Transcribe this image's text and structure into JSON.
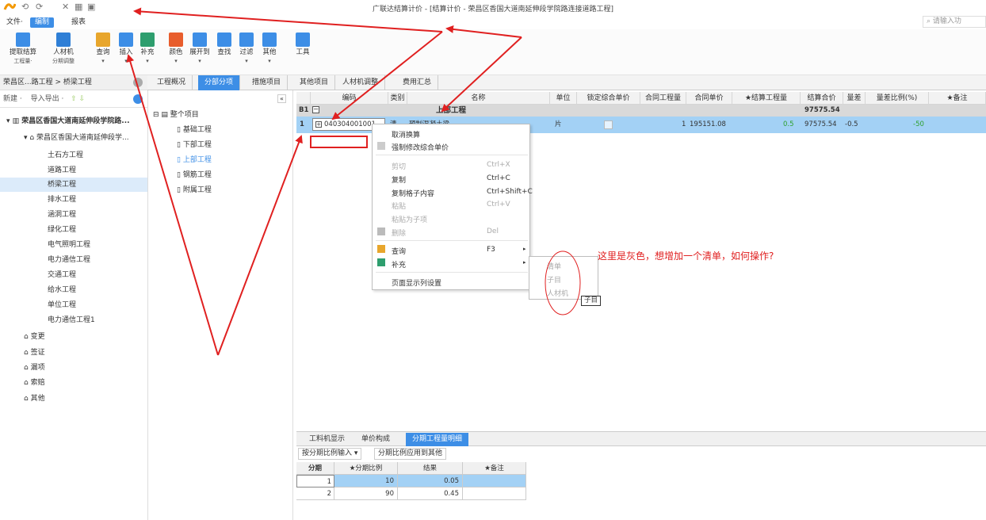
{
  "app": {
    "title": "广联达结算计价 - [结算计价 - 荣昌区香国大道南延伸段学院路连接道路工程]",
    "quick_access": [
      "⟲",
      "⟳",
      "✕",
      "▦",
      "▣"
    ]
  },
  "menu": {
    "tabs": [
      {
        "label": "文件·"
      },
      {
        "label": "编制"
      },
      {
        "label": "报表"
      }
    ],
    "search_placeholder": "请输入功"
  },
  "ribbon": {
    "buttons": [
      {
        "label": "提取结算",
        "sub": "工程量·"
      },
      {
        "label": "人材机",
        "sub": "分期调整"
      },
      {
        "label": "查询",
        "sub": "▾"
      },
      {
        "label": "插入",
        "sub": "▾"
      },
      {
        "label": "补充",
        "sub": "▾"
      },
      {
        "label": "颜色",
        "sub": "▾"
      },
      {
        "label": "展开到",
        "sub": "▾"
      },
      {
        "label": "查找",
        "sub": ""
      },
      {
        "label": "过滤",
        "sub": "▾"
      },
      {
        "label": "其他",
        "sub": "▾"
      },
      {
        "label": "工具",
        "sub": ""
      }
    ]
  },
  "left": {
    "breadcrumb": "荣昌区...路工程 > 桥梁工程",
    "toolbar": {
      "new": "新建 ·",
      "io": "导入导出 ·"
    },
    "project": "荣昌区香国大道南延伸段学院路...",
    "unit": "荣昌区香国大道南延伸段学...",
    "items": [
      "土石方工程",
      "道路工程",
      "桥梁工程",
      "排水工程",
      "涵洞工程",
      "绿化工程",
      "电气照明工程",
      "电力通信工程",
      "交通工程",
      "给水工程",
      "单位工程",
      "电力通信工程1"
    ],
    "extras": [
      "变更",
      "签证",
      "漏项",
      "索赔",
      "其他"
    ]
  },
  "mid": {
    "root": "整个项目",
    "nodes": [
      "基础工程",
      "下部工程",
      "上部工程",
      "钢筋工程",
      "附属工程"
    ]
  },
  "tabs": [
    "工程概况",
    "分部分项",
    "措施项目",
    "其他项目",
    "人材机调整",
    "费用汇总"
  ],
  "grid": {
    "headers": [
      "编码",
      "类别",
      "名称",
      "单位",
      "锁定综合单价",
      "合同工程量",
      "合同单价",
      "★结算工程量",
      "结算合价",
      "量差",
      "量差比例(%)",
      "★备注"
    ],
    "b1": {
      "index": "B1",
      "name": "上部工程",
      "total": "97575.54"
    },
    "row1": {
      "index": "1",
      "code": "040304001001",
      "type": "清",
      "name": "预制混凝土梁",
      "unit": "片",
      "contract_qty": "1",
      "contract_price": "195151.08",
      "settle_qty": "0.5",
      "settle_total": "97575.54",
      "diff": "-0.5",
      "diff_pct": "-50"
    }
  },
  "context_menu": {
    "items": [
      {
        "label": "取消换算",
        "key": ""
      },
      {
        "label": "强制修改综合单价",
        "key": ""
      },
      {
        "label": "剪切",
        "key": "Ctrl+X"
      },
      {
        "label": "复制",
        "key": "Ctrl+C"
      },
      {
        "label": "复制格子内容",
        "key": "Ctrl+Shift+C"
      },
      {
        "label": "粘贴",
        "key": "Ctrl+V"
      },
      {
        "label": "粘贴为子项",
        "key": ""
      },
      {
        "label": "删除",
        "key": "Del"
      },
      {
        "label": "查询",
        "key": "F3"
      },
      {
        "label": "补充",
        "key": ""
      },
      {
        "label": "页面显示列设置",
        "key": ""
      }
    ],
    "submenu": [
      "清单",
      "子目",
      "人材机"
    ],
    "tooltip": "子目"
  },
  "annotation": "这里是灰色，想增加一个清单，如何操作?",
  "bottom": {
    "tabs": [
      "工料机显示",
      "单价构成",
      "分期工程量明细"
    ],
    "mode": "按分期比例输入",
    "apply": "分期比例应用到其他",
    "headers": [
      "分期",
      "★分期比例",
      "结果",
      "★备注"
    ],
    "rows": [
      {
        "period": "1",
        "ratio": "10",
        "result": "0.05"
      },
      {
        "period": "2",
        "ratio": "90",
        "result": "0.45"
      }
    ]
  },
  "colors": {
    "accent": "#3d8ee6",
    "selected_row": "#a3d1f5",
    "annotation": "#e02020"
  }
}
